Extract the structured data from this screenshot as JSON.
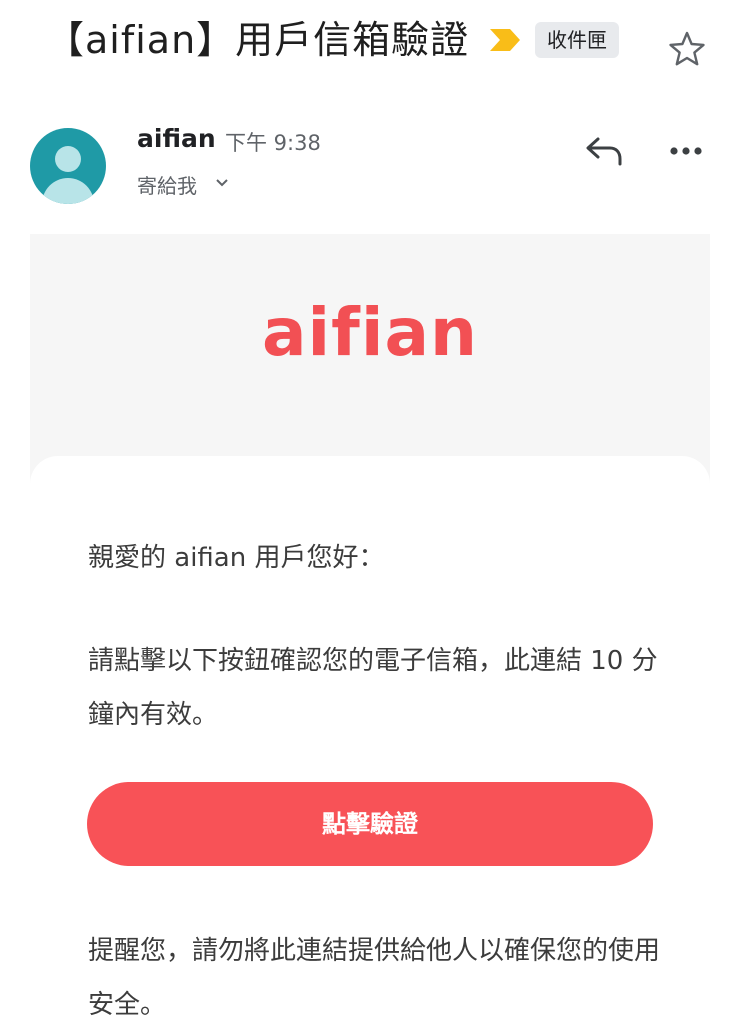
{
  "header": {
    "subject": "【aifian】用戶信箱驗證",
    "label": "收件匣",
    "importance_icon": "importance-marker-icon",
    "star_icon": "star-icon",
    "colors": {
      "importance": "#f9bd18",
      "chip_bg": "#e8eaed"
    }
  },
  "sender": {
    "name": "aifian",
    "time": "下午 9:38",
    "recipient": "寄給我",
    "avatar_icon": "person-avatar-icon",
    "reply_icon": "reply-icon",
    "more_icon": "more-options-icon"
  },
  "email": {
    "logo": "aifian",
    "greeting": "親愛的 aifian 用戶您好：",
    "instruction": "請點擊以下按鈕確認您的電子信箱，此連結 10 分鐘內有效。",
    "button_label": "點擊驗證",
    "reminder": "提醒您，請勿將此連結提供給他人以確保您的使用安全。",
    "colors": {
      "brand": "#f25054",
      "button": "#f85257"
    }
  }
}
